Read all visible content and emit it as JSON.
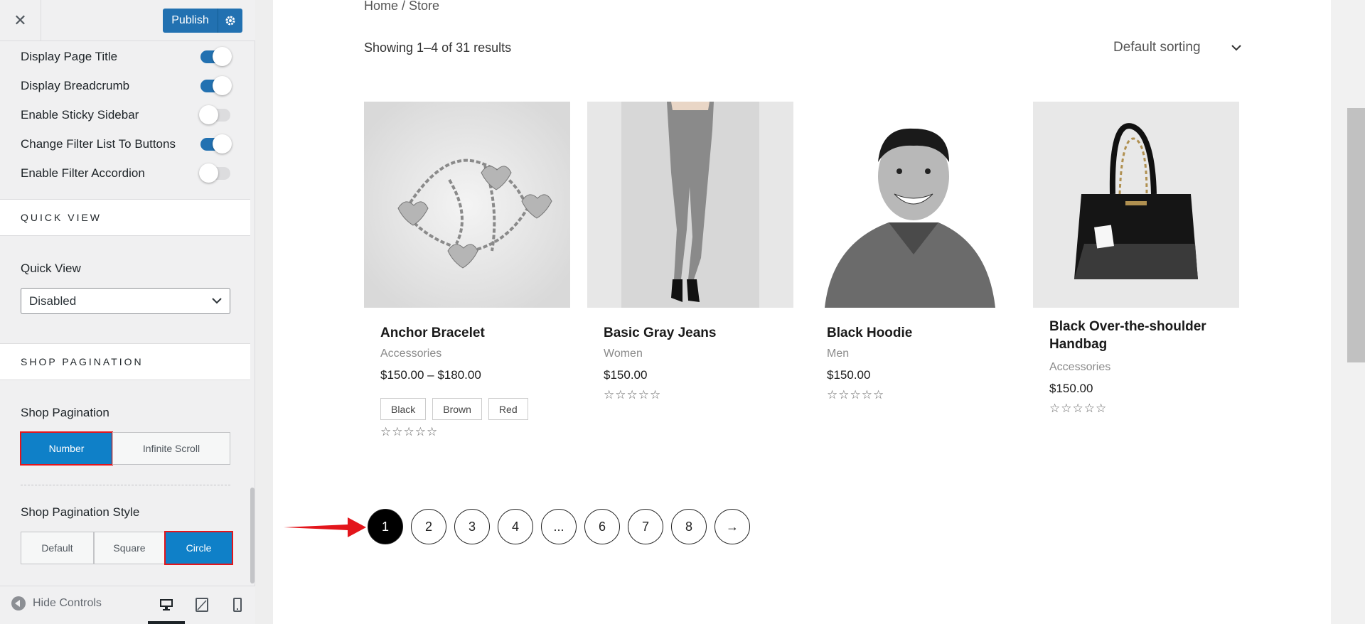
{
  "header": {
    "close_icon": "close-icon",
    "publish_label": "Publish",
    "settings_icon": "gear-icon"
  },
  "toggles": [
    {
      "label": "Display Page Title",
      "on": true
    },
    {
      "label": "Display Breadcrumb",
      "on": true
    },
    {
      "label": "Enable Sticky Sidebar",
      "on": false
    },
    {
      "label": "Change Filter List To Buttons",
      "on": true
    },
    {
      "label": "Enable Filter Accordion",
      "on": false
    }
  ],
  "quick_view": {
    "section_title": "QUICK VIEW",
    "label": "Quick View",
    "selected": "Disabled"
  },
  "shop_pagination": {
    "section_title": "SHOP PAGINATION",
    "label": "Shop Pagination",
    "options": [
      "Number",
      "Infinite Scroll"
    ],
    "selected": "Number",
    "style_label": "Shop Pagination Style",
    "style_options": [
      "Default",
      "Square",
      "Circle"
    ],
    "style_selected": "Circle"
  },
  "footer": {
    "hide_controls": "Hide Controls",
    "devices": [
      "desktop-icon",
      "tablet-icon",
      "mobile-icon"
    ],
    "active_device": "desktop"
  },
  "preview": {
    "breadcrumb": "Home / Store",
    "result_count": "Showing 1–4 of 31 results",
    "sorting": "Default sorting",
    "products": [
      {
        "title": "Anchor Bracelet",
        "category": "Accessories",
        "price": "$150.00 – $180.00",
        "swatches": [
          "Black",
          "Brown",
          "Red"
        ],
        "rating": "☆☆☆☆☆"
      },
      {
        "title": "Basic Gray Jeans",
        "category": "Women",
        "price": "$150.00",
        "rating": "☆☆☆☆☆"
      },
      {
        "title": "Black Hoodie",
        "category": "Men",
        "price": "$150.00",
        "rating": "☆☆☆☆☆"
      },
      {
        "title": "Black Over-the-shoulder Handbag",
        "category": "Accessories",
        "price": "$150.00",
        "rating": "☆☆☆☆☆"
      }
    ],
    "pagination": [
      "1",
      "2",
      "3",
      "4",
      "...",
      "6",
      "7",
      "8",
      "→"
    ],
    "current_page": "1"
  },
  "colors": {
    "accent": "#2271b1",
    "active_button": "#0f80c8",
    "highlight_box": "#e3151b"
  }
}
